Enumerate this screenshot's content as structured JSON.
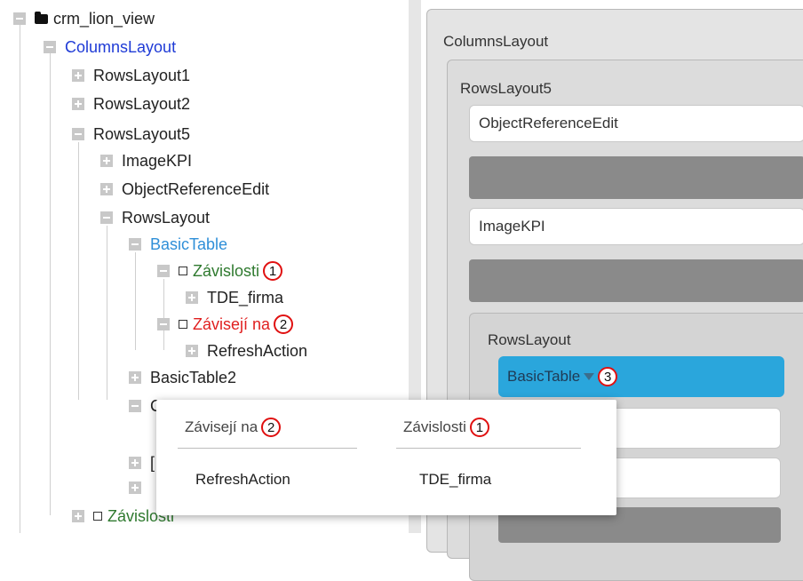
{
  "tree": {
    "root": "crm_lion_view",
    "columns_layout": "ColumnsLayout",
    "rows_layout1": "RowsLayout1",
    "rows_layout2": "RowsLayout2",
    "rows_layout5": "RowsLayout5",
    "image_kpi": "ImageKPI",
    "object_reference_edit": "ObjectReferenceEdit",
    "rows_layout": "RowsLayout",
    "basic_table": "BasicTable",
    "zavislosti": "Závislosti",
    "zavislosti_badge": "1",
    "tde_firma": "TDE_firma",
    "zavisi_na": "Závisejí na",
    "zavisi_na_badge": "2",
    "refresh_action": "RefreshAction",
    "basic_table2": "BasicTable2",
    "partial_c": "C",
    "partial_d": "[",
    "zavislosti_bottom": "Závislosti"
  },
  "preview": {
    "columns_layout": "ColumnsLayout",
    "rows_layout5": "RowsLayout5",
    "object_reference_edit": "ObjectReferenceEdit",
    "image_kpi": "ImageKPI",
    "rows_layout": "RowsLayout",
    "basic_table": "BasicTable",
    "basic_table_badge": "3"
  },
  "popup": {
    "col1_header": "Závisejí na",
    "col1_badge": "2",
    "col1_item": "RefreshAction",
    "col2_header": "Závislosti",
    "col2_badge": "1",
    "col2_item": "TDE_firma"
  },
  "colors": {
    "link_blue": "#1f3bd6",
    "table_blue": "#2f8fd8",
    "green": "#2f7a2f",
    "red": "#e02020",
    "highlight_bar": "#2aa6dc"
  }
}
